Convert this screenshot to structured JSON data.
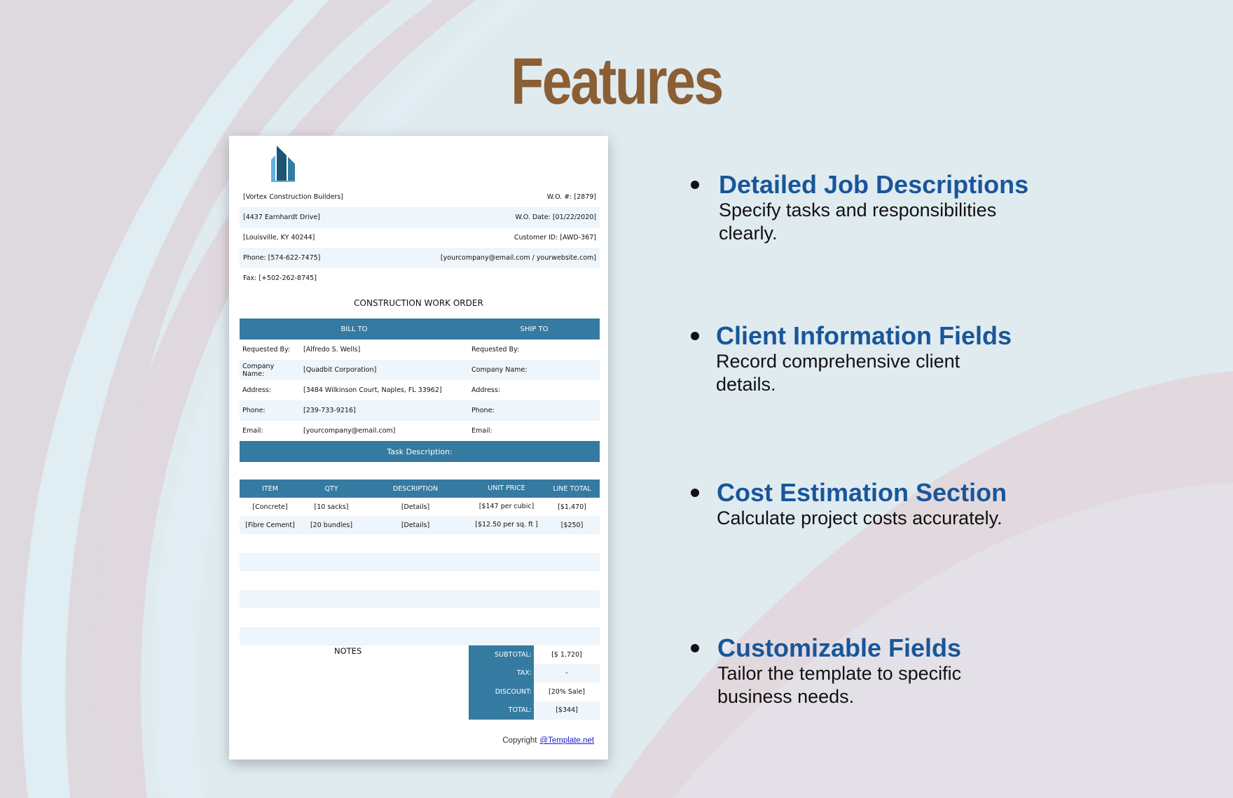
{
  "page": {
    "title": "Features",
    "colors": {
      "title": "#8b5e34",
      "feature_title": "#19569a",
      "accent": "#357aa1",
      "row_alt": "#eef5fb"
    }
  },
  "document": {
    "logo_icon": "building-logo-icon",
    "header_rows": [
      {
        "left": "[Vortex Construction Builders]",
        "right": "W.O. #: [2879]"
      },
      {
        "left": "[4437 Earnhardt Drive]",
        "right": "W.O. Date: [01/22/2020]"
      },
      {
        "left": "[Louisville, KY 40244]",
        "right": "Customer ID: [AWD-367]"
      },
      {
        "left": "Phone: [574-622-7475]",
        "right": "[yourcompany@email.com / yourwebsite.com]"
      },
      {
        "left": "Fax: [+502-262-8745]",
        "right": ""
      }
    ],
    "doc_title": "CONSTRUCTION WORK ORDER",
    "bill_to_label": "BILL TO",
    "ship_to_label": "SHIP TO",
    "info_rows": [
      {
        "label": "Requested By:",
        "value": "[Alfredo S. Wells]",
        "ship_label": "Requested By:"
      },
      {
        "label": "Company Name:",
        "value": "[Quadbit Corporation]",
        "ship_label": "Company Name:"
      },
      {
        "label": "Address:",
        "value": "[3484 Wilkinson Court, Naples, FL 33962]",
        "ship_label": "Address:"
      },
      {
        "label": "Phone:",
        "value": "[239-733-9216]",
        "ship_label": "Phone:"
      },
      {
        "label": "Email:",
        "value": "[yourcompany@email.com]",
        "ship_label": "Email:"
      }
    ],
    "task_description_label": "Task Description:",
    "table": {
      "headers": [
        "ITEM",
        "QTY",
        "DESCRIPTION",
        "UNIT PRICE",
        "LINE TOTAL"
      ],
      "rows": [
        [
          "[Concrete]",
          "[10 sacks]",
          "[Details]",
          "[$147 per cubic]",
          "[$1,470]"
        ],
        [
          "[Fibre Cement]",
          "[20 bundles]",
          "[Details]",
          "[$12.50 per sq. ft ]",
          "[$250]"
        ]
      ]
    },
    "notes_label": "NOTES",
    "totals": [
      {
        "label": "SUBTOTAL:",
        "value": "[$ 1,720]"
      },
      {
        "label": "TAX:",
        "value": "-"
      },
      {
        "label": "DISCOUNT:",
        "value": "[20% Sale]"
      },
      {
        "label": "TOTAL:",
        "value": "[$344]"
      }
    ],
    "copyright_label": "Copyright",
    "copyright_link": "@Template.net"
  },
  "features": [
    {
      "title": "Detailed Job Descriptions",
      "description": "Specify tasks and responsibilities clearly."
    },
    {
      "title": "Client Information Fields",
      "description": "Record comprehensive client details."
    },
    {
      "title": "Cost Estimation Section",
      "description": "Calculate project costs accurately."
    },
    {
      "title": "Customizable Fields",
      "description": "Tailor the template to specific business needs."
    }
  ]
}
